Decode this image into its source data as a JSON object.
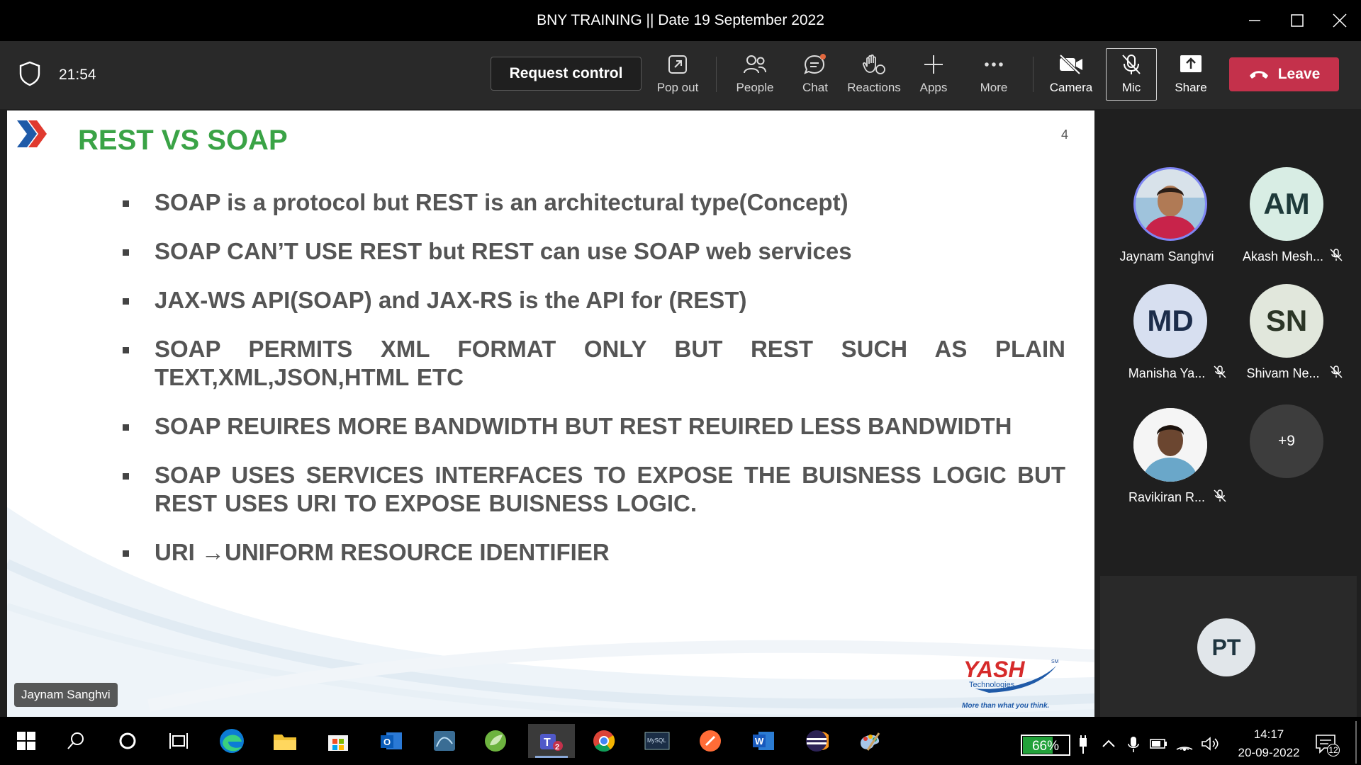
{
  "window": {
    "title": "BNY TRAINING || Date 19 September 2022"
  },
  "toolbar": {
    "timer": "21:54",
    "request_control": "Request control",
    "buttons": {
      "pop_out": "Pop out",
      "people": "People",
      "chat": "Chat",
      "reactions": "Reactions",
      "apps": "Apps",
      "more": "More",
      "camera": "Camera",
      "mic": "Mic",
      "share": "Share"
    },
    "leave": "Leave",
    "leave_color": "#c4314b"
  },
  "slide": {
    "title": "REST VS SOAP",
    "page_number": "4",
    "bullets": [
      "SOAP is a protocol but REST is an architectural type(Concept)",
      "SOAP CAN’T USE REST but REST can use SOAP web services",
      "JAX-WS API(SOAP) and JAX-RS is the API for (REST)",
      "SOAP PERMITS XML FORMAT ONLY BUT REST SUCH AS PLAIN TEXT,XML,JSON,HTML ETC",
      "SOAP REUIRES MORE BANDWIDTH BUT REST REUIRED LESS BANDWIDTH",
      "SOAP USES SERVICES INTERFACES TO EXPOSE THE BUISNESS LOGIC BUT REST USES URI TO EXPOSE BUISNESS LOGIC.",
      "URI →UNIFORM RESOURCE IDENTIFIER"
    ],
    "title_color": "#3aa346",
    "logo": {
      "name": "YASH",
      "sub": "Technologies",
      "tagline": "More than what you think.",
      "tm": "SM"
    },
    "presenter_label": "Jaynam Sanghvi"
  },
  "participants": [
    {
      "name": "Jaynam Sanghvi",
      "initials": "",
      "muted": false,
      "photo": true
    },
    {
      "name": "Akash Mesh...",
      "initials": "AM",
      "muted": true,
      "color": "#d8ede4"
    },
    {
      "name": "Manisha Ya...",
      "initials": "MD",
      "muted": true,
      "color": "#d7dff0"
    },
    {
      "name": "Shivam Ne...",
      "initials": "SN",
      "muted": true,
      "color": "#e1e7dc"
    },
    {
      "name": "Ravikiran R...",
      "initials": "",
      "muted": true,
      "photo": true
    },
    {
      "name": "",
      "initials": "+9",
      "overflow": true
    }
  ],
  "bottom_tile": {
    "initials": "PT"
  },
  "taskbar": {
    "battery": "66%",
    "battery_level": 0.66,
    "time": "14:17",
    "date": "20-09-2022",
    "notifications": "12",
    "apps": [
      "start-icon",
      "search-icon",
      "cortana-icon",
      "task-view-icon",
      "edge-icon",
      "file-explorer-icon",
      "store-icon",
      "outlook-icon",
      "mysql-workbench-icon",
      "teams-icon",
      "chrome-icon",
      "mysql-icon",
      "postman-icon",
      "word-icon",
      "eclipse-icon",
      "paint-icon"
    ]
  }
}
